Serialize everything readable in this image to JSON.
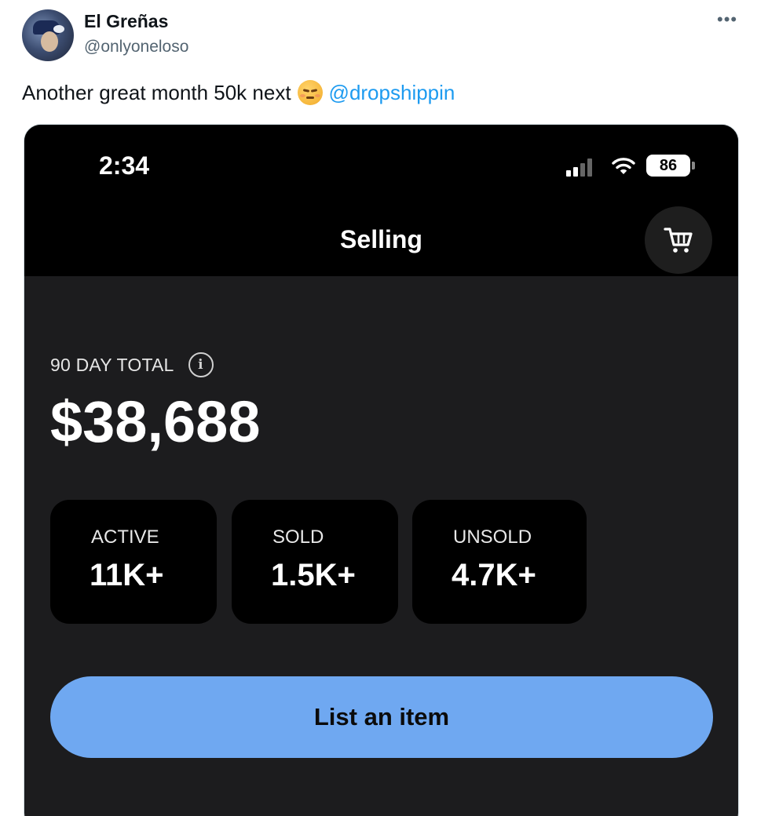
{
  "author": {
    "display_name": "El Greñas",
    "handle": "@onlyoneloso"
  },
  "more_icon": "more-horizontal-icon",
  "tweet": {
    "text": "Another great month 50k next",
    "emoji": "pensive-face-emoji",
    "mention": "@dropshippin",
    "mention_color": "#1d9bf0"
  },
  "phone": {
    "status_bar": {
      "time": "2:34",
      "battery": "86"
    },
    "screen_title": "Selling",
    "cart_icon": "cart-icon",
    "total": {
      "label": "90 DAY TOTAL",
      "value": "$38,688"
    },
    "stats": [
      {
        "label": "ACTIVE",
        "value": "11K+"
      },
      {
        "label": "SOLD",
        "value": "1.5K+"
      },
      {
        "label": "UNSOLD",
        "value": "4.7K+"
      }
    ],
    "primary_button": {
      "label": "List an item",
      "color": "#6fa8f1"
    }
  }
}
